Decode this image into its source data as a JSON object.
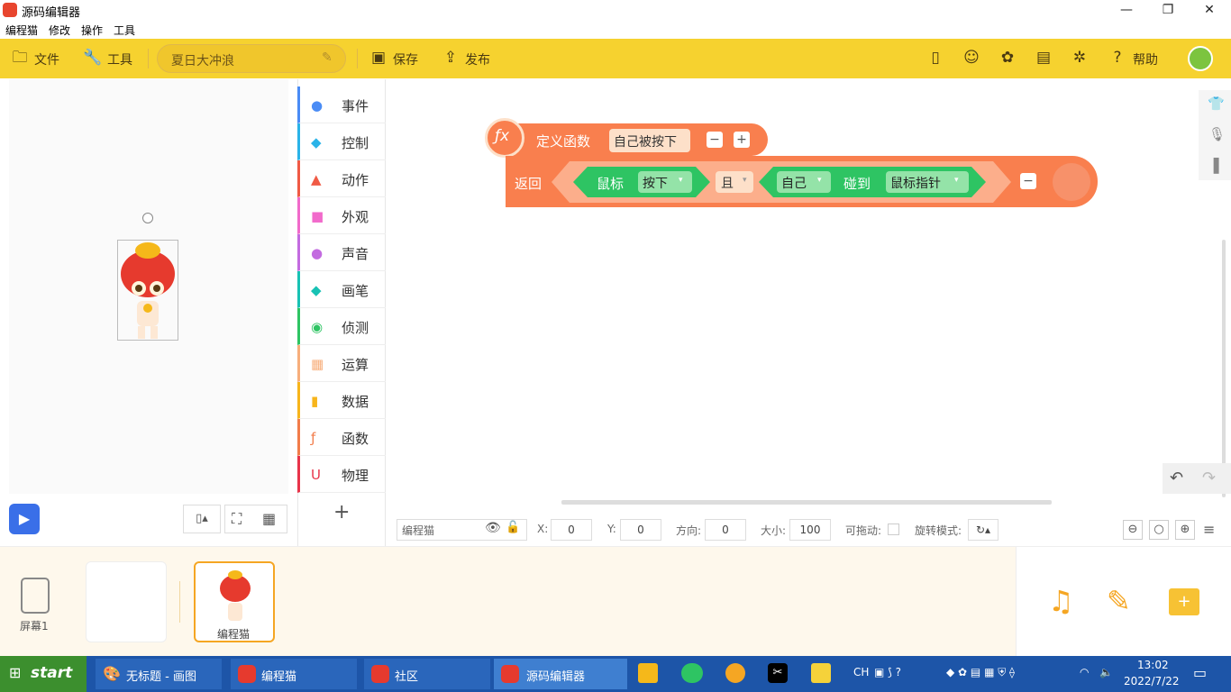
{
  "window": {
    "title": "源码编辑器",
    "min": "—",
    "max": "❐",
    "close": "✕"
  },
  "menu": [
    "编程猫",
    "修改",
    "操作",
    "工具"
  ],
  "toolbar": {
    "file": "文件",
    "tools": "工具",
    "project_name": "夏日大冲浪",
    "save": "保存",
    "publish": "发布",
    "help": "帮助"
  },
  "categories": [
    {
      "label": "事件",
      "color": "#4a8cf5"
    },
    {
      "label": "控制",
      "color": "#2ab3e8"
    },
    {
      "label": "动作",
      "color": "#f05a45"
    },
    {
      "label": "外观",
      "color": "#f16acb"
    },
    {
      "label": "声音",
      "color": "#c36be0"
    },
    {
      "label": "画笔",
      "color": "#18c2b4"
    },
    {
      "label": "侦测",
      "color": "#2ec463"
    },
    {
      "label": "运算",
      "color": "#f7ae7b"
    },
    {
      "label": "数据",
      "color": "#f7b51c"
    },
    {
      "label": "函数",
      "color": "#f27c4a"
    },
    {
      "label": "物理",
      "color": "#e8344a"
    }
  ],
  "blocks": {
    "def_label": "定义函数",
    "func_name": "自己被按下",
    "ret_label": "返回",
    "mouse": "鼠标",
    "pressed": "按下",
    "and": "且",
    "self": "自己",
    "touch": "碰到",
    "pointer": "鼠标指针"
  },
  "props": {
    "sprite": "编程猫",
    "x_label": "X:",
    "x": "0",
    "y_label": "Y:",
    "y": "0",
    "dir_label": "方向:",
    "dir": "0",
    "size_label": "大小:",
    "size": "100",
    "drag_label": "可拖动:",
    "rot_label": "旋转模式:"
  },
  "bottom": {
    "screen": "屏幕1",
    "sprite": "编程猫"
  },
  "taskbar": {
    "start": "start",
    "tasks": [
      "无标题 - 画图",
      "编程猫",
      "社区",
      "源码编辑器"
    ],
    "lang": "CH",
    "time": "13:02",
    "date": "2022/7/22"
  }
}
